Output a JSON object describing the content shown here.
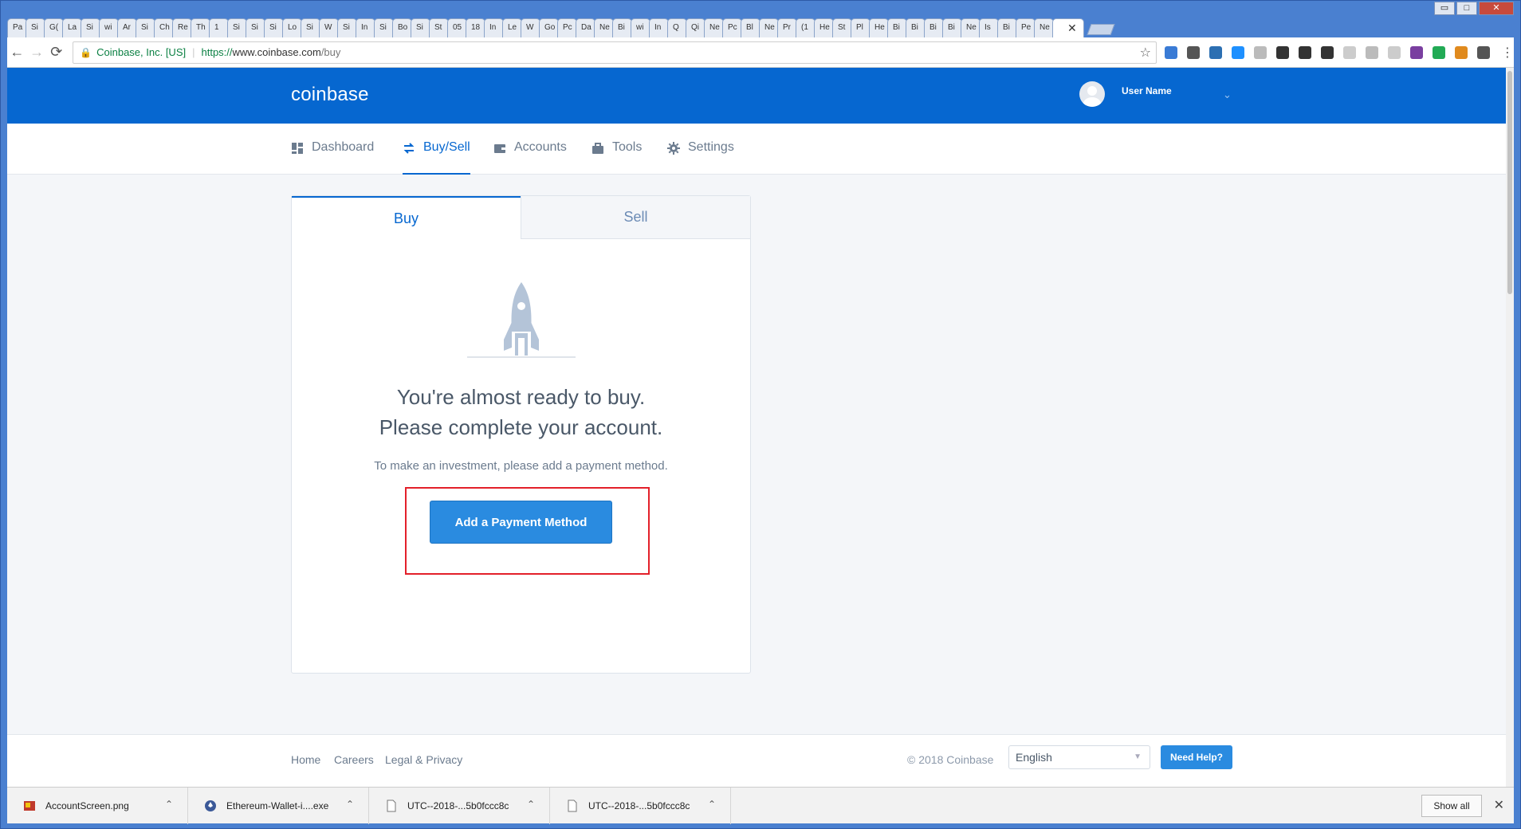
{
  "browser": {
    "tab_labels": [
      "Pa",
      "Si",
      "G(",
      "La",
      "Si",
      "wi",
      "Ar",
      "Si",
      "Ch",
      "Re",
      "Th",
      "1",
      "Si",
      "Si",
      "Si",
      "Lo",
      "Si",
      "W",
      "Si",
      "In",
      "Si",
      "Bo",
      "Si",
      "St",
      "05",
      "18",
      "In",
      "Le",
      "W",
      "Go",
      "Pc",
      "Da",
      "Ne",
      "Bi",
      "wi",
      "In",
      "Q",
      "Qi",
      "Ne",
      "Pc",
      "Bl",
      "Ne",
      "Pr",
      "(1",
      "He",
      "St",
      "Pl",
      "He",
      "Bi",
      "Bi",
      "Bi",
      "Bi",
      "Ne",
      "Is",
      "Bi",
      "Pe",
      "Ne"
    ],
    "active_tab_close": "✕",
    "window_controls": {
      "minimize": "▭",
      "restore": "□",
      "close": "✕"
    },
    "back": "←",
    "forward": "→",
    "reload": "⟳",
    "site_identity": "Coinbase, Inc. [US]",
    "url_scheme": "https://",
    "url_host": "www.coinbase.com",
    "url_path": "/buy",
    "bookmark_star": "☆",
    "menu": "⋮",
    "extension_colors": [
      "#3a7bd5",
      "#555555",
      "#2c6fb2",
      "#1e90ff",
      "#bbbbbb",
      "#333333",
      "#333333",
      "#333333",
      "#cccccc",
      "#bbbbbb",
      "#cccccc",
      "#7a3fa0",
      "#22aa55",
      "#e08a1e",
      "#555555"
    ]
  },
  "header": {
    "logo": "coinbase",
    "user_name": "User Name",
    "chevron": "⌄"
  },
  "nav": {
    "items": [
      {
        "label": "Dashboard"
      },
      {
        "label": "Buy/Sell"
      },
      {
        "label": "Accounts"
      },
      {
        "label": "Tools"
      },
      {
        "label": "Settings"
      }
    ]
  },
  "card": {
    "tab_buy": "Buy",
    "tab_sell": "Sell",
    "headline_1": "You're almost ready to buy.",
    "headline_2": "Please complete your account.",
    "subtext": "To make an investment, please add a payment method.",
    "cta": "Add a Payment Method"
  },
  "footer": {
    "links": [
      "Home",
      "Careers",
      "Legal & Privacy"
    ],
    "copyright": "© 2018 Coinbase",
    "language": "English",
    "help": "Need Help?"
  },
  "downloads": {
    "items": [
      {
        "name": "AccountScreen.png"
      },
      {
        "name": "Ethereum-Wallet-i....exe"
      },
      {
        "name": "UTC--2018-...5b0fccc8c"
      },
      {
        "name": "UTC--2018-...5b0fccc8c"
      }
    ],
    "show_all": "Show all",
    "close": "✕"
  },
  "colors": {
    "brand": "#0667d0",
    "cta": "#2a8be0",
    "highlight": "#e3202a"
  }
}
